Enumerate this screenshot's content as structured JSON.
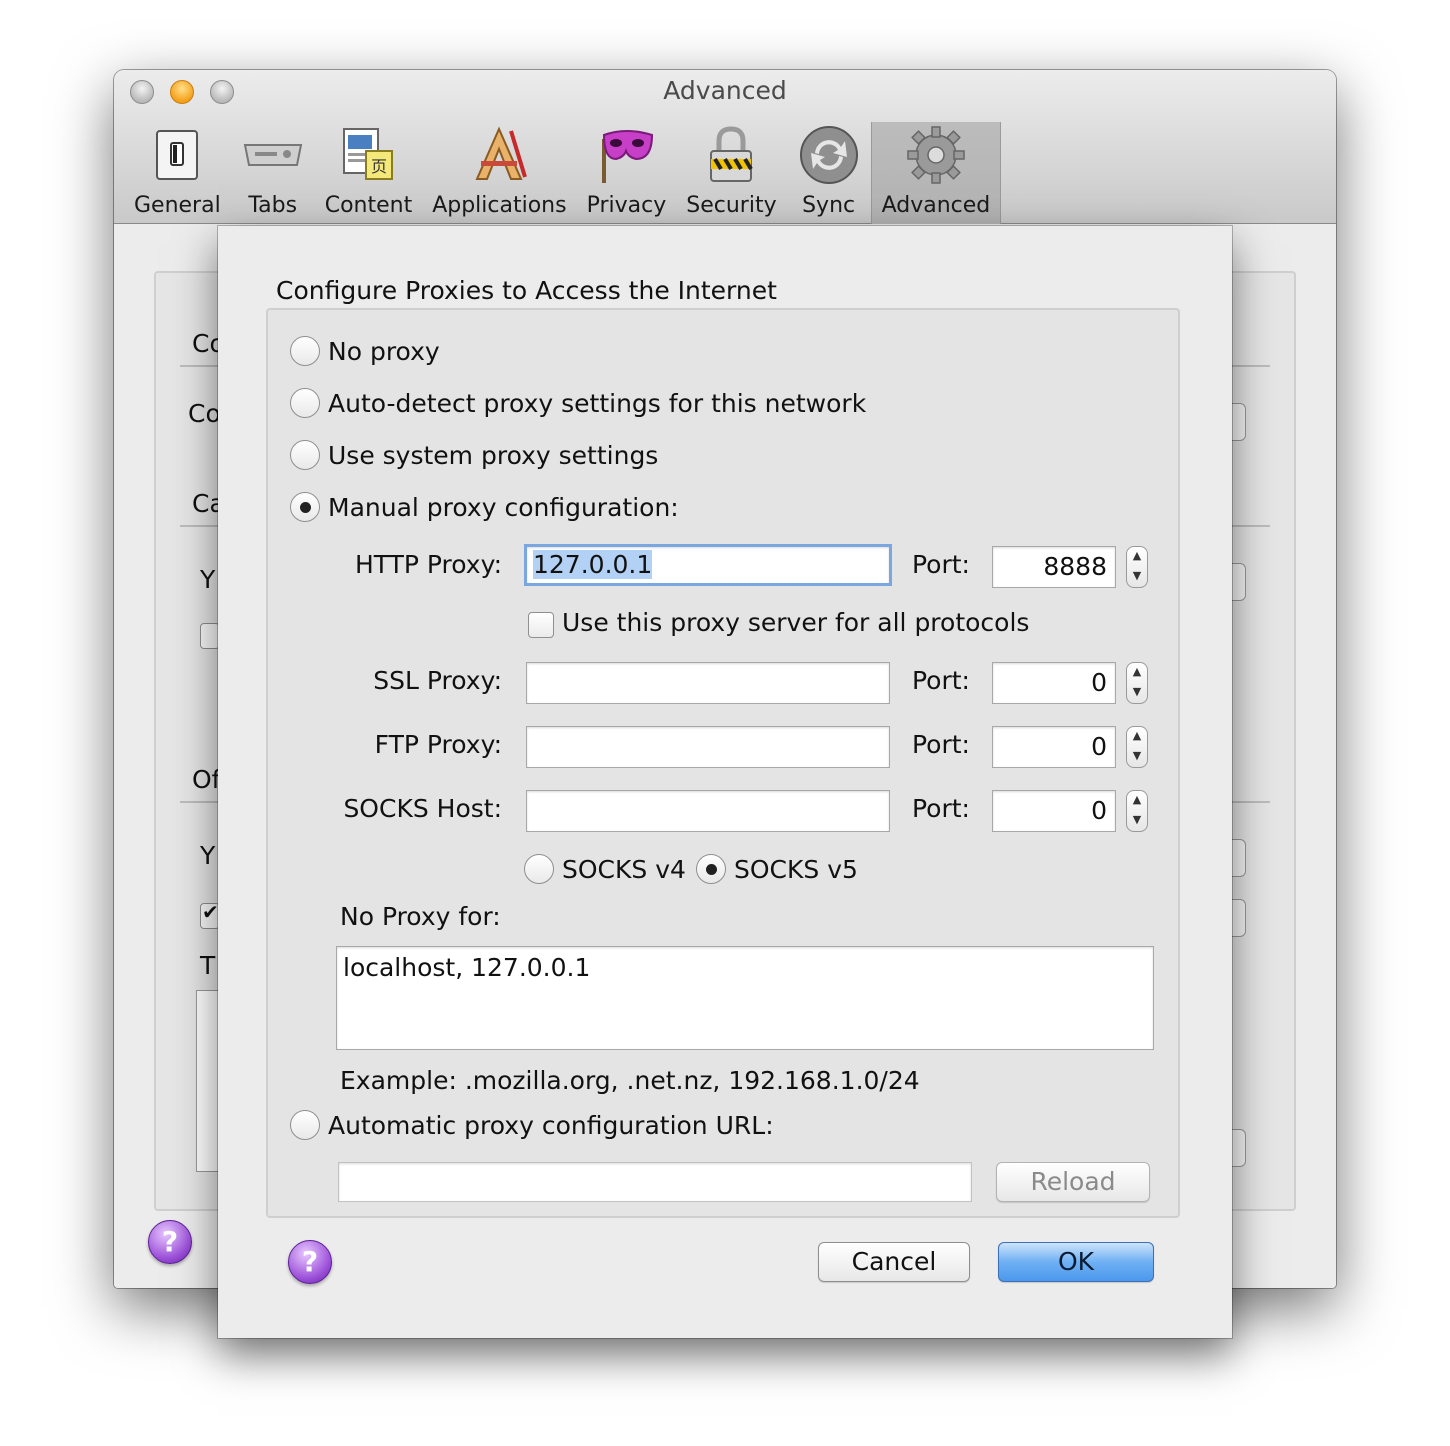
{
  "window": {
    "title": "Advanced",
    "toolbar": [
      {
        "label": "General",
        "icon": "switch-icon"
      },
      {
        "label": "Tabs",
        "icon": "tabs-icon"
      },
      {
        "label": "Content",
        "icon": "content-icon"
      },
      {
        "label": "Applications",
        "icon": "applications-icon"
      },
      {
        "label": "Privacy",
        "icon": "mask-icon"
      },
      {
        "label": "Security",
        "icon": "lock-icon"
      },
      {
        "label": "Sync",
        "icon": "sync-icon"
      },
      {
        "label": "Advanced",
        "icon": "gear-icon",
        "selected": true
      }
    ],
    "background_fragments": [
      "Co",
      "Co",
      "Ca",
      "Y",
      "Of",
      "Y",
      "T"
    ]
  },
  "sheet": {
    "heading": "Configure Proxies to Access the Internet",
    "options": {
      "no_proxy": "No proxy",
      "auto_detect": "Auto-detect proxy settings for this network",
      "system": "Use system proxy settings",
      "manual": "Manual proxy configuration:",
      "auto_url": "Automatic proxy configuration URL:"
    },
    "selected_option": "manual",
    "http": {
      "label": "HTTP Proxy:",
      "value": "127.0.0.1",
      "port_label": "Port:",
      "port": "8888"
    },
    "share_all": {
      "label": "Use this proxy server for all protocols",
      "checked": false
    },
    "ssl": {
      "label": "SSL Proxy:",
      "value": "",
      "port_label": "Port:",
      "port": "0"
    },
    "ftp": {
      "label": "FTP Proxy:",
      "value": "",
      "port_label": "Port:",
      "port": "0"
    },
    "socks": {
      "label": "SOCKS Host:",
      "value": "",
      "port_label": "Port:",
      "port": "0"
    },
    "socks_version": {
      "v4": "SOCKS v4",
      "v5": "SOCKS v5",
      "selected": "v5"
    },
    "no_proxy_for": {
      "label": "No Proxy for:",
      "value": "localhost, 127.0.0.1"
    },
    "example": "Example: .mozilla.org, .net.nz, 192.168.1.0/24",
    "auto_url_value": "",
    "buttons": {
      "reload": "Reload",
      "cancel": "Cancel",
      "ok": "OK"
    },
    "help": "?"
  },
  "colors": {
    "accent": "#4b98ec",
    "selection": "#b3d0f5",
    "focus_ring": "#7aa7e0",
    "help": "#9b4fd8"
  }
}
